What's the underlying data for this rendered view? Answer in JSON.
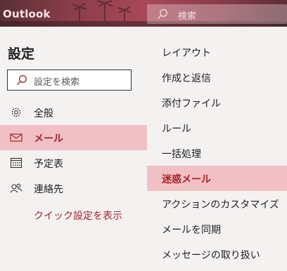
{
  "header": {
    "app_title": "Outlook",
    "search_label": "検索"
  },
  "settings": {
    "title": "設定",
    "search_placeholder": "設定を検索"
  },
  "nav": [
    {
      "label": "全般",
      "icon": "gear-icon",
      "selected": false
    },
    {
      "label": "メール",
      "icon": "mail-icon",
      "selected": true
    },
    {
      "label": "予定表",
      "icon": "calendar-icon",
      "selected": false
    },
    {
      "label": "連絡先",
      "icon": "people-icon",
      "selected": false
    }
  ],
  "quick_settings_link": "クイック設定を表示",
  "mail_subnav": [
    {
      "label": "レイアウト",
      "selected": false
    },
    {
      "label": "作成と返信",
      "selected": false
    },
    {
      "label": "添付ファイル",
      "selected": false
    },
    {
      "label": "ルール",
      "selected": false
    },
    {
      "label": "一括処理",
      "selected": false
    },
    {
      "label": "迷惑メール",
      "selected": true
    },
    {
      "label": "アクションのカスタマイズ",
      "selected": false
    },
    {
      "label": "メールを同期",
      "selected": false
    },
    {
      "label": "メッセージの取り扱い",
      "selected": false
    }
  ],
  "colors": {
    "accent": "#a4262c",
    "selected_bg": "#f0c0c4",
    "pane_bg": "#f4f2f1"
  }
}
